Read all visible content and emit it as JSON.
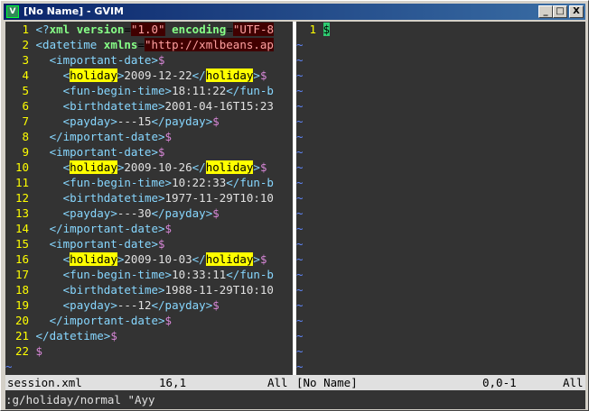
{
  "window": {
    "title": "[No Name] - GVIM",
    "min_label": "_",
    "max_label": "□",
    "close_label": "X"
  },
  "left_lines": [
    {
      "n": "1",
      "html": "<span class='tl'>&lt;?</span><span class='at'>xml</span> <span class='at'>version</span>=<span class='av'>\"1.0\"</span> <span class='at'>encoding</span>=<span class='av'>\"UTF-8</span>"
    },
    {
      "n": "2",
      "html": "<span class='tl'>&lt;datetime</span> <span class='at'>xmlns</span>=<span class='av'>\"http://xmlbeans.ap</span>"
    },
    {
      "n": "3",
      "html": "  <span class='tl'>&lt;important-date&gt;</span><span class='eol'>$</span>"
    },
    {
      "n": "4",
      "html": "    <span class='tl'>&lt;</span><span class='hl'>holiday</span><span class='tl'>&gt;</span><span class='tx'>2009-12-22</span><span class='tl'>&lt;/</span><span class='hl'>holiday</span><span class='tl'>&gt;</span><span class='eol'>$</span>"
    },
    {
      "n": "5",
      "html": "    <span class='tl'>&lt;fun-begin-time&gt;</span><span class='tx'>18:11:22</span><span class='tl'>&lt;/fun-b</span>"
    },
    {
      "n": "6",
      "html": "    <span class='tl'>&lt;birthdatetime&gt;</span><span class='tx'>2001-04-16T15:23</span>"
    },
    {
      "n": "7",
      "html": "    <span class='tl'>&lt;payday&gt;</span><span class='tx'>---15</span><span class='tl'>&lt;/payday&gt;</span><span class='eol'>$</span>"
    },
    {
      "n": "8",
      "html": "  <span class='tl'>&lt;/important-date&gt;</span><span class='eol'>$</span>"
    },
    {
      "n": "9",
      "html": "  <span class='tl'>&lt;important-date&gt;</span><span class='eol'>$</span>"
    },
    {
      "n": "10",
      "html": "    <span class='tl'>&lt;</span><span class='hl'>holiday</span><span class='tl'>&gt;</span><span class='tx'>2009-10-26</span><span class='tl'>&lt;/</span><span class='hl'>holiday</span><span class='tl'>&gt;</span><span class='eol'>$</span>"
    },
    {
      "n": "11",
      "html": "    <span class='tl'>&lt;fun-begin-time&gt;</span><span class='tx'>10:22:33</span><span class='tl'>&lt;/fun-b</span>"
    },
    {
      "n": "12",
      "html": "    <span class='tl'>&lt;birthdatetime&gt;</span><span class='tx'>1977-11-29T10:10</span>"
    },
    {
      "n": "13",
      "html": "    <span class='tl'>&lt;payday&gt;</span><span class='tx'>---30</span><span class='tl'>&lt;/payday&gt;</span><span class='eol'>$</span>"
    },
    {
      "n": "14",
      "html": "  <span class='tl'>&lt;/important-date&gt;</span><span class='eol'>$</span>"
    },
    {
      "n": "15",
      "html": "  <span class='tl'>&lt;important-date&gt;</span><span class='eol'>$</span>"
    },
    {
      "n": "16",
      "html": "    <span class='tl'>&lt;</span><span class='hl'>holiday</span><span class='tl'>&gt;</span><span class='tx'>2009-10-03</span><span class='tl'>&lt;/</span><span class='hl'>holiday</span><span class='tl'>&gt;</span><span class='eol'>$</span>"
    },
    {
      "n": "17",
      "html": "    <span class='tl'>&lt;fun-begin-time&gt;</span><span class='tx'>10:33:11</span><span class='tl'>&lt;/fun-b</span>"
    },
    {
      "n": "18",
      "html": "    <span class='tl'>&lt;birthdatetime&gt;</span><span class='tx'>1988-11-29T10:10</span>"
    },
    {
      "n": "19",
      "html": "    <span class='tl'>&lt;payday&gt;</span><span class='tx'>---12</span><span class='tl'>&lt;/payday&gt;</span><span class='eol'>$</span>"
    },
    {
      "n": "20",
      "html": "  <span class='tl'>&lt;/important-date&gt;</span><span class='eol'>$</span>"
    },
    {
      "n": "21",
      "html": "<span class='tl'>&lt;/datetime&gt;</span><span class='eol'>$</span>"
    },
    {
      "n": "22",
      "html": "<span class='eol'>$</span>"
    }
  ],
  "right_first_line": {
    "n": "1",
    "html": "<span class='cursor'>$</span>"
  },
  "tilde": "~",
  "status": {
    "left_file": "session.xml",
    "left_pos": "16,1",
    "left_pct": "All",
    "right_file": "[No Name]",
    "right_pos": "0,0-1",
    "right_pct": "All"
  },
  "command_line": ":g/holiday/normal \"Ayy",
  "colors": {
    "background": "#333333",
    "tag": "#87d7ff",
    "line_number": "#ffff00",
    "search_highlight": "#ffff00"
  }
}
